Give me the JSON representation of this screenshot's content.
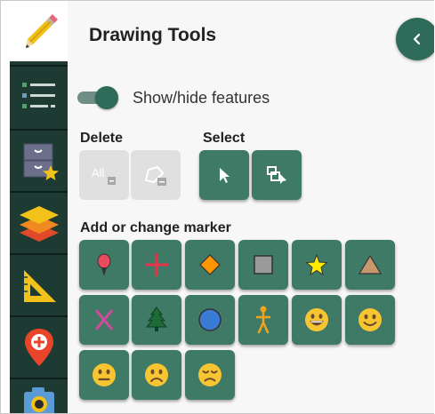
{
  "panel": {
    "title": "Drawing Tools"
  },
  "toggle": {
    "label": "Show/hide features",
    "on": true
  },
  "delete": {
    "label": "Delete",
    "all_label": "All"
  },
  "select": {
    "label": "Select"
  },
  "markers": {
    "label": "Add or change marker"
  },
  "sidebar": {
    "items": [
      {
        "icon": "pencil-icon",
        "active": true
      },
      {
        "icon": "list-icon"
      },
      {
        "icon": "bookmarks-icon"
      },
      {
        "icon": "layers-icon"
      },
      {
        "icon": "ruler-triangle-icon"
      },
      {
        "icon": "location-pin-icon"
      },
      {
        "icon": "camera-icon"
      }
    ]
  },
  "colors": {
    "sidebar": "#1d3a33",
    "accent": "#3f7a66",
    "disabled": "#e0e0e0"
  }
}
